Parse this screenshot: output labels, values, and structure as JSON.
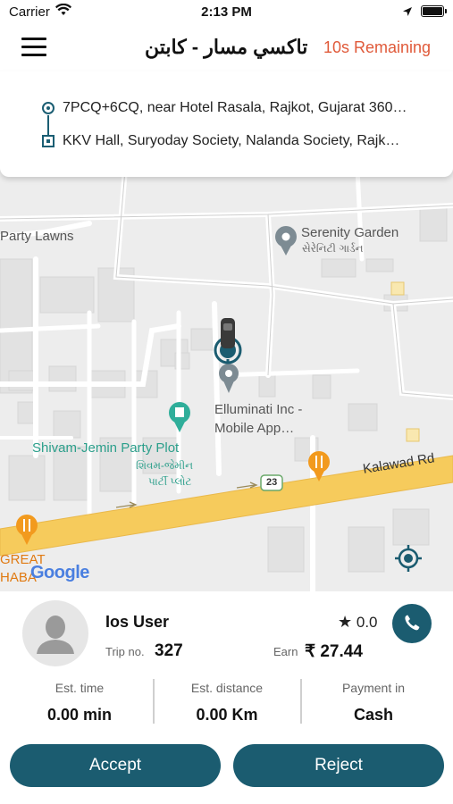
{
  "status_bar": {
    "carrier": "Carrier",
    "time": "2:13 PM"
  },
  "header": {
    "title": "تاكسي مسار - كابتن",
    "timer": "10s Remaining"
  },
  "route": {
    "pickup": "7PCQ+6CQ, near Hotel Rasala, Rajkot, Gujarat 360…",
    "dropoff": "KKV Hall, Suryoday Society, Nalanda Society, Rajk…"
  },
  "map": {
    "labels": {
      "party_lawns": "Party Lawns",
      "serenity": "Serenity Garden",
      "serenity_gu": "સેરેનિટી ગાર્ડન",
      "elluminati_1": "Elluminati Inc -",
      "elluminati_2": "Mobile App…",
      "shivam": "Shivam-Jemin Party Plot",
      "shivam_gu_1": "શિવમ-જેમીન",
      "shivam_gu_2": "પાર્ટી પ્લોટ",
      "kalawad": "Kalawad Rd",
      "road_num": "23",
      "great": "GREAT",
      "dhaba": "HABA",
      "google": "Google"
    }
  },
  "rider": {
    "name": "Ios User",
    "rating": "0.0",
    "trip_label": "Trip no.",
    "trip_no": "327",
    "earn_label": "Earn",
    "earn_value": "₹ 27.44"
  },
  "stats": [
    {
      "label": "Est. time",
      "value": "0.00 min"
    },
    {
      "label": "Est. distance",
      "value": "0.00  Km"
    },
    {
      "label": "Payment in",
      "value": "Cash"
    }
  ],
  "actions": {
    "accept": "Accept",
    "reject": "Reject"
  },
  "colors": {
    "primary": "#1b5c70",
    "timer": "#e05a3a",
    "poi_green": "#2c9f8b",
    "road": "#f6cb5c"
  }
}
